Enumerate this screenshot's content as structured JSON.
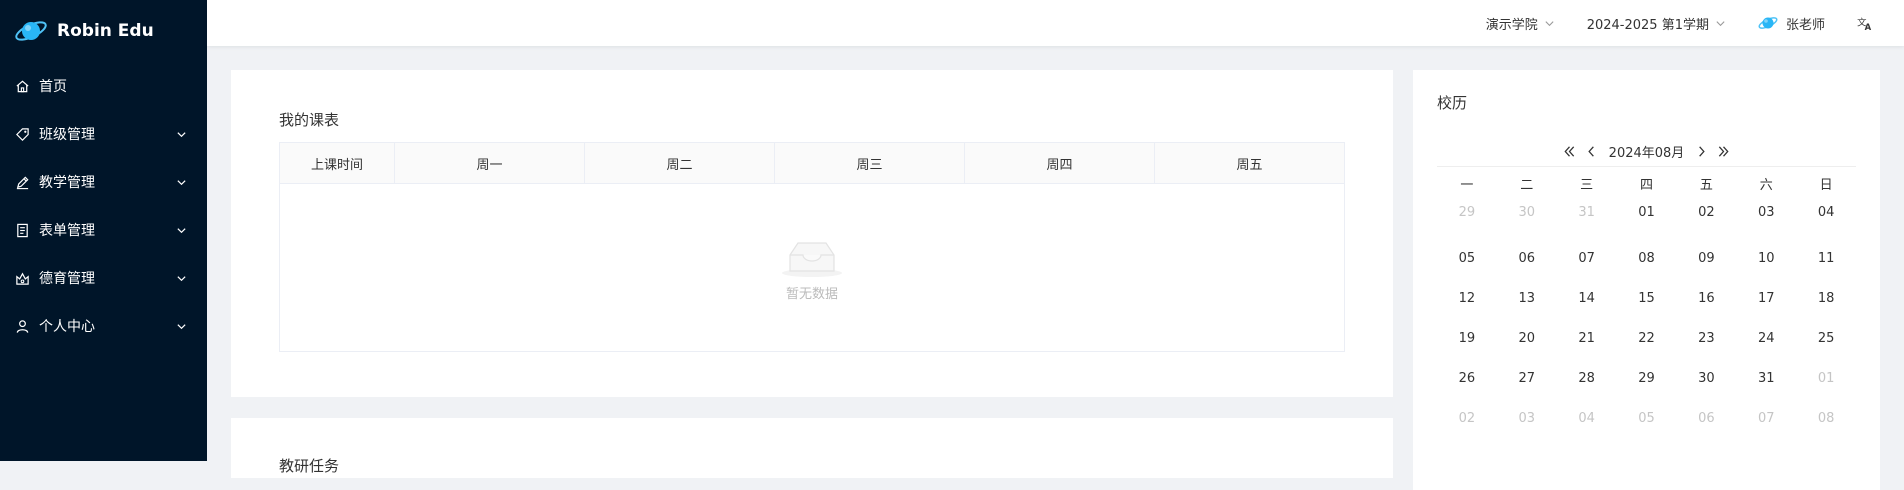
{
  "brand": {
    "name": "Robin Edu"
  },
  "sidebar": {
    "items": [
      {
        "label": "首页",
        "icon": "home-icon",
        "has_submenu": false
      },
      {
        "label": "班级管理",
        "icon": "tag-icon",
        "has_submenu": true
      },
      {
        "label": "教学管理",
        "icon": "pen-icon",
        "has_submenu": true
      },
      {
        "label": "表单管理",
        "icon": "form-icon",
        "has_submenu": true
      },
      {
        "label": "德育管理",
        "icon": "badge-icon",
        "has_submenu": true
      },
      {
        "label": "个人中心",
        "icon": "user-icon",
        "has_submenu": true
      }
    ]
  },
  "header": {
    "school": "演示学院",
    "term": "2024-2025 第1学期",
    "user": "张老师",
    "language_icon": "translate-icon"
  },
  "schedule": {
    "title": "我的课表",
    "columns": [
      "上课时间",
      "周一",
      "周二",
      "周三",
      "周四",
      "周五"
    ],
    "empty_text": "暂无数据"
  },
  "tasks": {
    "title": "教研任务"
  },
  "calendar": {
    "title": "校历",
    "month_label": "2024年08月",
    "weekdays": [
      "一",
      "二",
      "三",
      "四",
      "五",
      "六",
      "日"
    ],
    "weeks": [
      [
        {
          "d": "29",
          "m": true
        },
        {
          "d": "30",
          "m": true
        },
        {
          "d": "31",
          "m": true
        },
        {
          "d": "01"
        },
        {
          "d": "02"
        },
        {
          "d": "03"
        },
        {
          "d": "04"
        }
      ],
      [
        {
          "d": "05"
        },
        {
          "d": "06"
        },
        {
          "d": "07"
        },
        {
          "d": "08"
        },
        {
          "d": "09"
        },
        {
          "d": "10"
        },
        {
          "d": "11"
        }
      ],
      [
        {
          "d": "12"
        },
        {
          "d": "13"
        },
        {
          "d": "14"
        },
        {
          "d": "15"
        },
        {
          "d": "16"
        },
        {
          "d": "17"
        },
        {
          "d": "18"
        }
      ],
      [
        {
          "d": "19"
        },
        {
          "d": "20"
        },
        {
          "d": "21"
        },
        {
          "d": "22"
        },
        {
          "d": "23"
        },
        {
          "d": "24"
        },
        {
          "d": "25"
        }
      ],
      [
        {
          "d": "26"
        },
        {
          "d": "27"
        },
        {
          "d": "28"
        },
        {
          "d": "29"
        },
        {
          "d": "30"
        },
        {
          "d": "31"
        },
        {
          "d": "01",
          "m": true
        }
      ],
      [
        {
          "d": "02",
          "m": true
        },
        {
          "d": "03",
          "m": true
        },
        {
          "d": "04",
          "m": true
        },
        {
          "d": "05",
          "m": true
        },
        {
          "d": "06",
          "m": true
        },
        {
          "d": "07",
          "m": true
        },
        {
          "d": "08",
          "m": true
        }
      ]
    ]
  },
  "colors": {
    "sidebar_bg": "#001529",
    "page_bg": "#f0f2f5",
    "muted_text": "#c5c5c5",
    "brand_accent": "#1890ff"
  }
}
